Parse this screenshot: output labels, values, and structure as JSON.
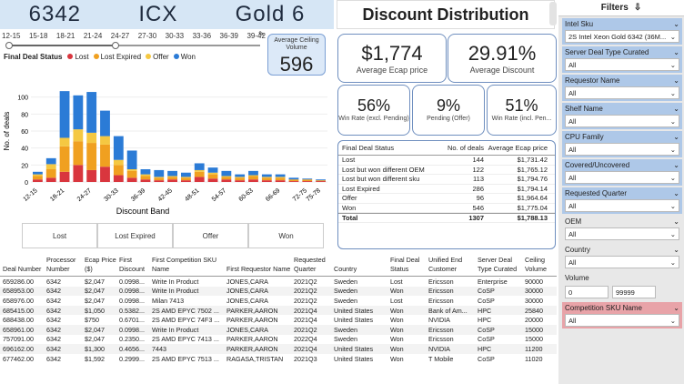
{
  "header": {
    "sku_num": "6342",
    "family": "ICX",
    "tier": "Gold 6"
  },
  "title": "Discount Distribution",
  "bands": [
    "12-15",
    "15-18",
    "18-21",
    "21-24",
    "24-27",
    "27-30",
    "30-33",
    "33-36",
    "36-39",
    "39-42"
  ],
  "avg_ceiling": {
    "label": "Average Ceiling Volume",
    "value": "596"
  },
  "legend": {
    "title": "Final Deal Status",
    "items": [
      {
        "name": "Lost",
        "color": "#d9363e"
      },
      {
        "name": "Lost Expired",
        "color": "#f0a020"
      },
      {
        "name": "Offer",
        "color": "#f5c842"
      },
      {
        "name": "Won",
        "color": "#2b7bd6"
      }
    ]
  },
  "chart_data": {
    "type": "bar",
    "stacked": true,
    "ylabel": "No. of deals",
    "xlabel": "Discount Band",
    "categories": [
      "12-15",
      "15-18",
      "18-21",
      "21-24",
      "24-27",
      "27-30",
      "30-33",
      "33-36",
      "36-39",
      "39-42",
      "42-45",
      "45-48",
      "48-51",
      "51-54",
      "54-57",
      "57-60",
      "60-63",
      "63-66",
      "66-69",
      "69-72",
      "72-75",
      "75-78"
    ],
    "x_labels": [
      "12-15",
      "18-21",
      "24-27",
      "30-33",
      "36-39",
      "42-45",
      "48-51",
      "54-57",
      "60-63",
      "66-69",
      "72-75",
      "75-78"
    ],
    "series": [
      {
        "name": "Lost",
        "values": [
          3,
          5,
          12,
          20,
          14,
          18,
          8,
          5,
          3,
          2,
          3,
          2,
          6,
          4,
          3,
          2,
          3,
          2,
          2,
          1,
          1,
          1
        ]
      },
      {
        "name": "Lost Expired",
        "values": [
          4,
          10,
          30,
          28,
          32,
          26,
          12,
          8,
          4,
          3,
          3,
          3,
          6,
          5,
          3,
          3,
          4,
          3,
          3,
          2,
          2,
          1
        ]
      },
      {
        "name": "Offer",
        "values": [
          2,
          6,
          10,
          14,
          12,
          10,
          6,
          2,
          2,
          1,
          1,
          1,
          2,
          2,
          1,
          1,
          1,
          1,
          1,
          0,
          0,
          0
        ]
      },
      {
        "name": "Won",
        "values": [
          3,
          7,
          55,
          40,
          48,
          30,
          28,
          22,
          6,
          8,
          6,
          5,
          8,
          6,
          6,
          3,
          5,
          3,
          3,
          2,
          1,
          1
        ]
      }
    ]
  },
  "kpis": {
    "ecap": {
      "value": "$1,774",
      "label": "Average Ecap price"
    },
    "discount": {
      "value": "29.91%",
      "label": "Average Discount"
    },
    "win_excl": {
      "value": "56%",
      "label": "Win Rate (excl. Pending)"
    },
    "pending": {
      "value": "9%",
      "label": "Pending (Offer)"
    },
    "win_incl": {
      "value": "51%",
      "label": "Win Rate (incl. Pen..."
    }
  },
  "status_table": {
    "headers": [
      "Final Deal Status",
      "No. of deals",
      "Average Ecap price"
    ],
    "rows": [
      [
        "Lost",
        "144",
        "$1,731.42"
      ],
      [
        "Lost but won different OEM",
        "122",
        "$1,765.12"
      ],
      [
        "Lost but won different sku",
        "113",
        "$1,794.76"
      ],
      [
        "Lost Expired",
        "286",
        "$1,794.14"
      ],
      [
        "Offer",
        "96",
        "$1,964.64"
      ],
      [
        "Won",
        "546",
        "$1,775.04"
      ]
    ],
    "total": [
      "Total",
      "1307",
      "$1,788.13"
    ]
  },
  "status_buttons": [
    "Lost",
    "Lost Expired",
    "Offer",
    "Won"
  ],
  "deals": {
    "headers": [
      "Deal Number",
      "Processor Number",
      "Ecap Price ($)",
      "First Discount",
      "First Competition SKU Name",
      "First Requestor Name",
      "Requested Quarter",
      "Country",
      "Final Deal Status",
      "Unified End Customer",
      "Server Deal Type Curated",
      "Ceiling Volume"
    ],
    "rows": [
      [
        "659286.00",
        "6342",
        "$2,047",
        "0.0998...",
        "Write In Product",
        "JONES,CARA",
        "2021Q2",
        "Sweden",
        "Lost",
        "Ericsson",
        "Enterprise",
        "90000"
      ],
      [
        "658953.00",
        "6342",
        "$2,047",
        "0.0998...",
        "Write In Product",
        "JONES,CARA",
        "2021Q2",
        "Sweden",
        "Won",
        "Ericsson",
        "CoSP",
        "30000"
      ],
      [
        "658976.00",
        "6342",
        "$2,047",
        "0.0998...",
        "Milan 7413",
        "JONES,CARA",
        "2021Q2",
        "Sweden",
        "Lost",
        "Ericsson",
        "CoSP",
        "30000"
      ],
      [
        "685415.00",
        "6342",
        "$1,050",
        "0.5382...",
        "2S AMD EPYC 7502 ...",
        "PARKER,AARON",
        "2021Q4",
        "United States",
        "Won",
        "Bank of Am...",
        "HPC",
        "25840"
      ],
      [
        "688438.00",
        "6342",
        "$750",
        "0.6701...",
        "2S AMD EPYC 74F3 ...",
        "PARKER,AARON",
        "2021Q4",
        "United States",
        "Won",
        "NVIDIA",
        "HPC",
        "20000"
      ],
      [
        "658961.00",
        "6342",
        "$2,047",
        "0.0998...",
        "Write In Product",
        "JONES,CARA",
        "2021Q2",
        "Sweden",
        "Won",
        "Ericsson",
        "CoSP",
        "15000"
      ],
      [
        "757091.00",
        "6342",
        "$2,047",
        "0.2350...",
        "2S AMD EPYC 7413 ...",
        "PARKER,AARON",
        "2022Q4",
        "Sweden",
        "Won",
        "Ericsson",
        "CoSP",
        "15000"
      ],
      [
        "696162.00",
        "6342",
        "$1,300",
        "0.4656...",
        "7443",
        "PARKER,AARON",
        "2021Q4",
        "United States",
        "Won",
        "NVIDIA",
        "HPC",
        "11200"
      ],
      [
        "677462.00",
        "6342",
        "$1,592",
        "0.2999...",
        "2S AMD EPYC 7513 ...",
        "RAGASA,TRISTAN",
        "2021Q3",
        "United States",
        "Won",
        "T Mobile",
        "CoSP",
        "11020"
      ]
    ]
  },
  "filters": {
    "title": "Filters",
    "items": [
      {
        "label": "Intel Sku",
        "value": "2S Intel Xeon Gold 6342 (36M..."
      },
      {
        "label": "Server Deal Type Curated",
        "value": "All"
      },
      {
        "label": "Requestor Name",
        "value": "All"
      },
      {
        "label": "Shelf Name",
        "value": "All"
      },
      {
        "label": "CPU Family",
        "value": "All"
      },
      {
        "label": "Covered/Uncovered",
        "value": "All"
      },
      {
        "label": "Requested Quarter",
        "value": "All"
      },
      {
        "label": "OEM",
        "value": "All"
      },
      {
        "label": "Country",
        "value": "All"
      }
    ],
    "volume": {
      "label": "Volume",
      "min": "0",
      "max": "99999"
    },
    "competition": {
      "label": "Competition SKU Name",
      "value": "All"
    }
  }
}
